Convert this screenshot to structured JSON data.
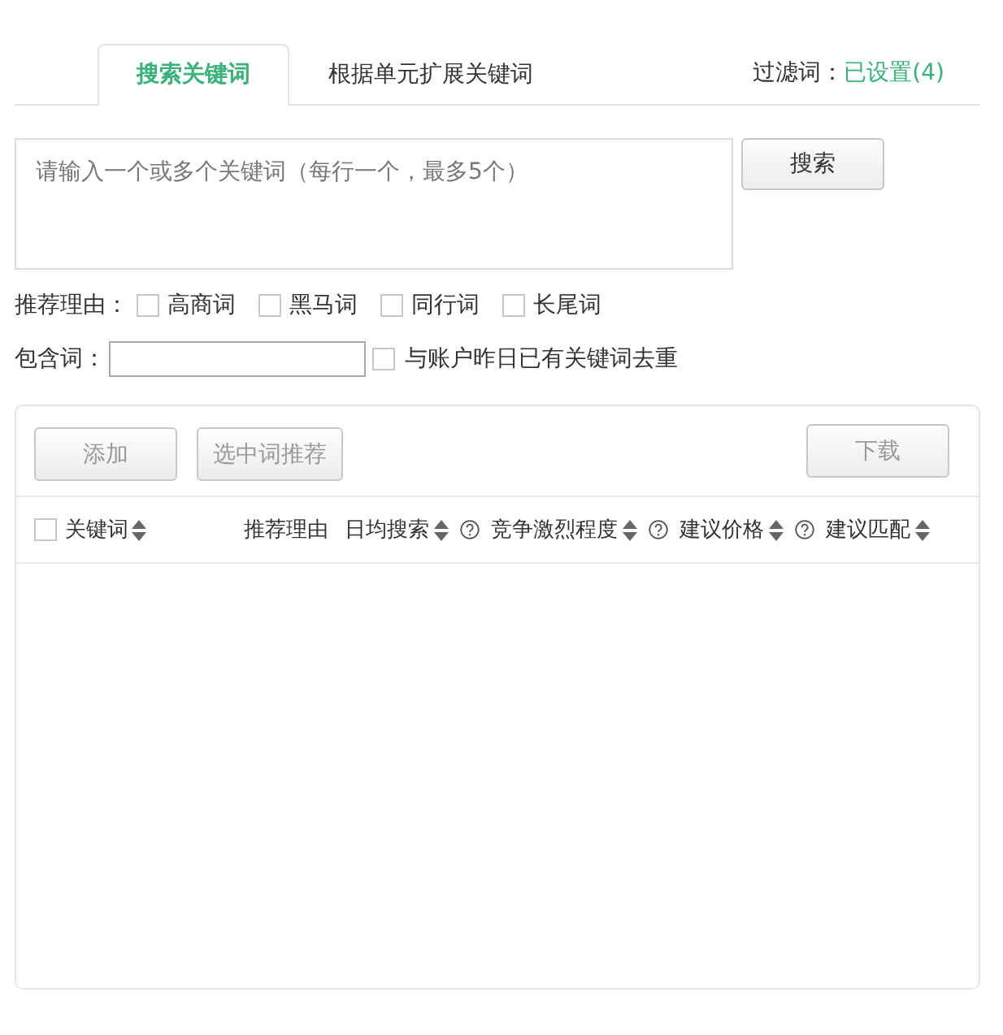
{
  "tabs": [
    {
      "label": "搜索关键词",
      "selected": true
    },
    {
      "label": "根据单元扩展关键词",
      "selected": false
    }
  ],
  "filter": {
    "label": "过滤词：",
    "value": "已设置(4)"
  },
  "keyword_input": {
    "placeholder": "请输入一个或多个关键词（每行一个，最多5个）"
  },
  "search_button": {
    "label": "搜索",
    "disabled": false
  },
  "reasons": {
    "label": "推荐理由：",
    "options": [
      {
        "label": "高商词",
        "checked": false
      },
      {
        "label": "黑马词",
        "checked": false
      },
      {
        "label": "同行词",
        "checked": false
      },
      {
        "label": "长尾词",
        "checked": false
      }
    ]
  },
  "include": {
    "label": "包含词：",
    "dedupe": {
      "label": "与账户昨日已有关键词去重",
      "checked": false
    }
  },
  "toolbar": {
    "left_buttons": [
      {
        "label": "添加",
        "disabled": true
      },
      {
        "label": "选中词推荐",
        "disabled": true
      }
    ],
    "right_buttons": [
      {
        "label": "下载",
        "disabled": true
      }
    ]
  },
  "table": {
    "select_all": {
      "checked": false
    },
    "columns": [
      {
        "label": "关键词",
        "sortable": true,
        "help": false
      },
      {
        "label": "推荐理由",
        "sortable": false,
        "help": false
      },
      {
        "label": "日均搜索",
        "sortable": true,
        "help": true
      },
      {
        "label": "竞争激烈程度",
        "sortable": true,
        "help": true
      },
      {
        "label": "建议价格",
        "sortable": true,
        "help": true
      },
      {
        "label": "建议匹配",
        "sortable": true,
        "help": false
      }
    ]
  }
}
